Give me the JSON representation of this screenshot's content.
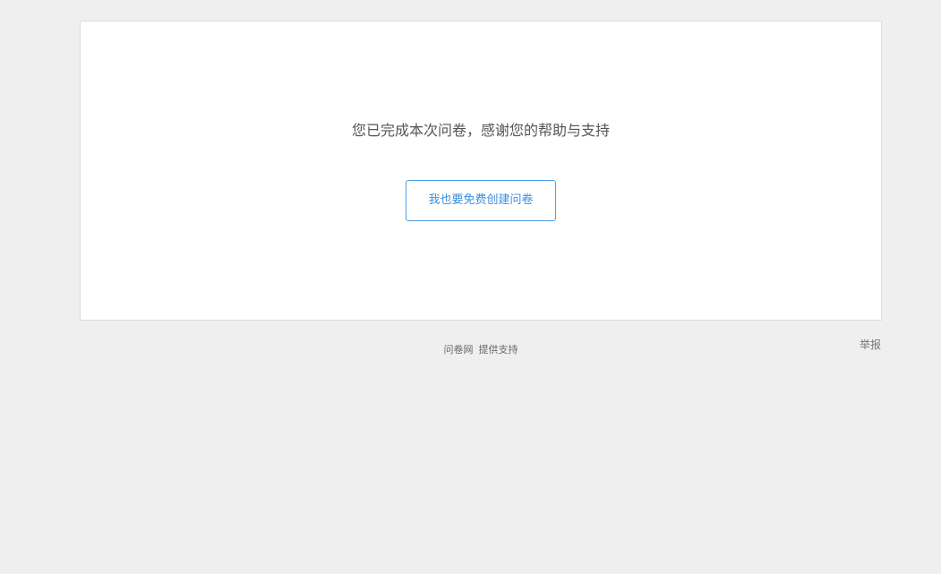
{
  "main": {
    "thanks_message": "您已完成本次问卷，感谢您的帮助与支持",
    "create_button_label": "我也要免费创建问卷"
  },
  "footer": {
    "brand": "问卷网",
    "support_text": "提供支持",
    "report_link": "举报"
  },
  "colors": {
    "background": "#efefef",
    "card": "#ffffff",
    "accent": "#3b8fe0"
  }
}
